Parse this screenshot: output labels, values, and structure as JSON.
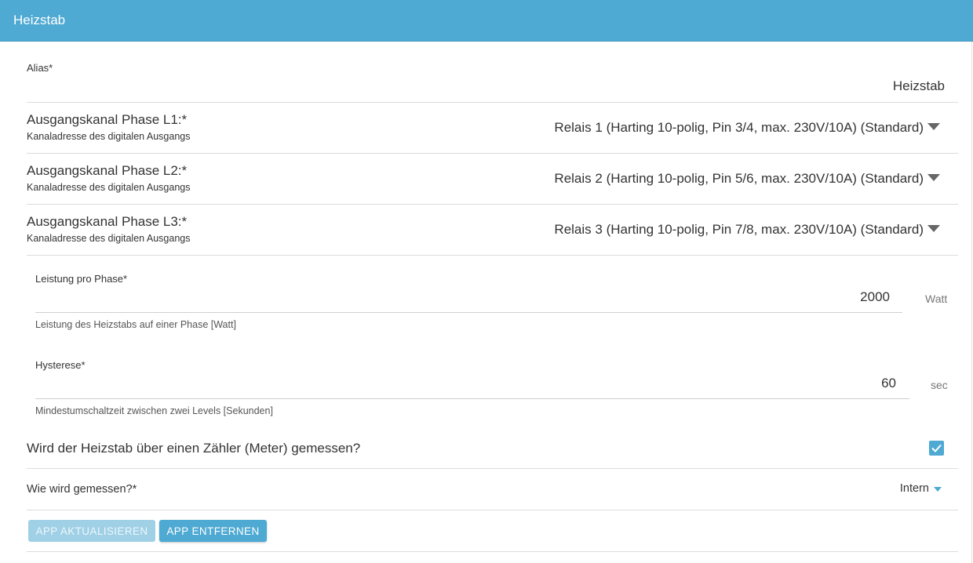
{
  "header": {
    "title": "Heizstab"
  },
  "alias": {
    "label": "Alias*",
    "value": "Heizstab"
  },
  "phases": [
    {
      "label": "Ausgangskanal Phase L1:*",
      "hint": "Kanaladresse des digitalen Ausgangs",
      "selected": "Relais 1 (Harting 10-polig, Pin 3/4, max. 230V/10A) (Standard)"
    },
    {
      "label": "Ausgangskanal Phase L2:*",
      "hint": "Kanaladresse des digitalen Ausgangs",
      "selected": "Relais 2 (Harting 10-polig, Pin 5/6, max. 230V/10A) (Standard)"
    },
    {
      "label": "Ausgangskanal Phase L3:*",
      "hint": "Kanaladresse des digitalen Ausgangs",
      "selected": "Relais 3 (Harting 10-polig, Pin 7/8, max. 230V/10A) (Standard)"
    }
  ],
  "power": {
    "label": "Leistung pro Phase*",
    "value": "2000",
    "unit": "Watt",
    "hint": "Leistung des Heizstabs auf einer Phase [Watt]"
  },
  "hysteresis": {
    "label": "Hysterese*",
    "value": "60",
    "unit": "sec",
    "hint": "Mindestumschaltzeit zwischen zwei Levels [Sekunden]"
  },
  "meter_question": {
    "label": "Wird der Heizstab über einen Zähler (Meter) gemessen?",
    "checked": true
  },
  "measure": {
    "label": "Wie wird gemessen?*",
    "selected": "Intern"
  },
  "buttons": {
    "update": "APP AKTUALISIEREN",
    "remove": "APP ENTFERNEN"
  },
  "colors": {
    "accent": "#4ea9d3",
    "header_bg": "#4ea9d3"
  }
}
